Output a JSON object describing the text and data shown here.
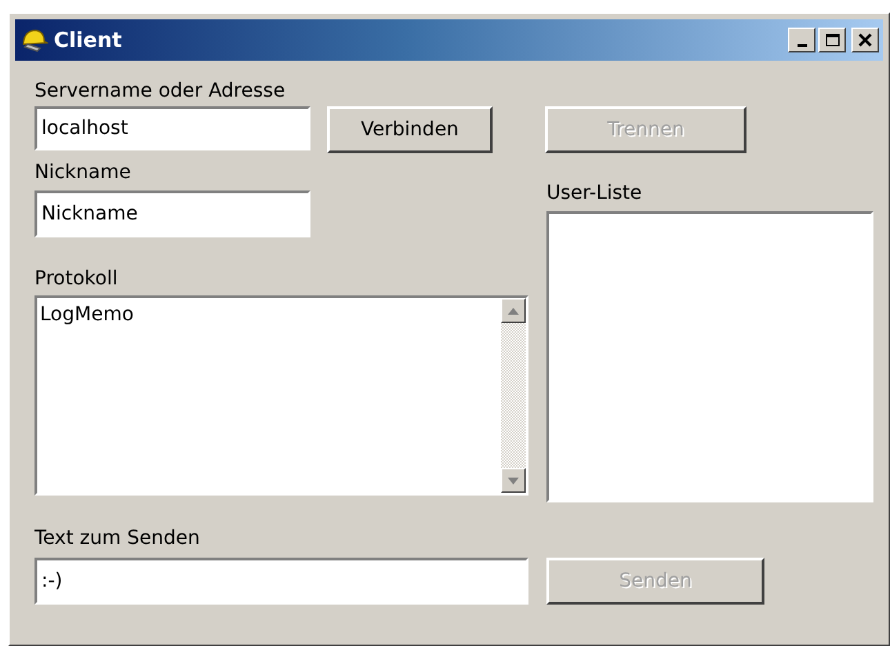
{
  "window": {
    "title": "Client"
  },
  "server": {
    "label": "Servername oder Adresse",
    "value": "localhost"
  },
  "buttons": [
    {
      "label": "Verbinden",
      "disabled": false
    },
    {
      "label": "Trennen",
      "disabled": true
    }
  ],
  "nickname": {
    "label": "Nickname",
    "value": "Nickname"
  },
  "log": {
    "label": "Protokoll",
    "value": "LogMemo"
  },
  "user_list": {
    "label": "User-Liste"
  },
  "message": {
    "label": "Text zum Senden",
    "value": ":-)"
  },
  "send_button": {
    "label": "Senden",
    "disabled": true
  }
}
